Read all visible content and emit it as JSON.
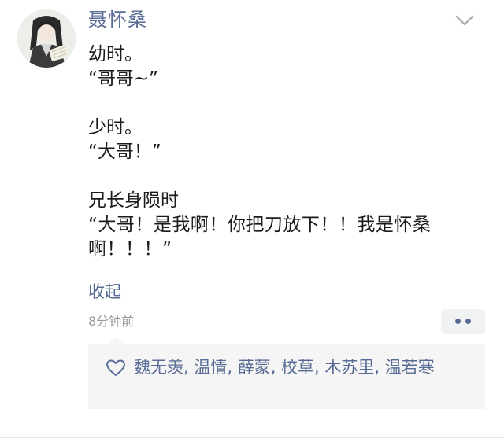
{
  "post": {
    "author": "聂怀桑",
    "lines": [
      "幼时。",
      "“哥哥~”",
      "",
      "少时。",
      "“大哥！”",
      "",
      "兄长身陨时",
      "“大哥！是我啊！你把刀放下！！我是怀桑啊！！！”"
    ],
    "collapse_label": "收起",
    "time": "8分钟前",
    "likes": "魏无羡, 温情, 薛蒙, 校草, 木苏里, 温若寒"
  },
  "icons": {
    "avatar": "avatar",
    "expand": "chevron-down-icon",
    "more": "more-dots-icon",
    "like": "heart-outline-icon"
  },
  "colors": {
    "link": "#576b95",
    "text": "#1b1b1b",
    "meta": "#9a9a9a",
    "panel": "#f5f5f5"
  }
}
